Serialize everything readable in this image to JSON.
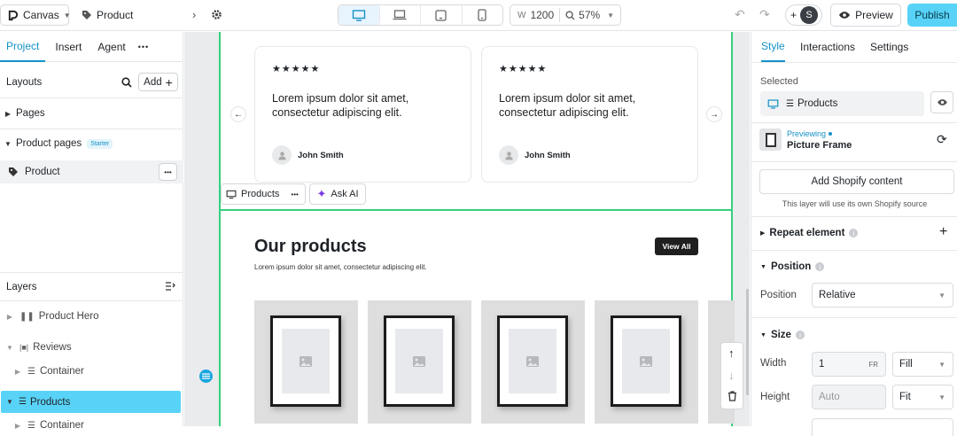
{
  "topbar": {
    "app_label": "Canvas",
    "page_label": "Product",
    "width_prefix": "W",
    "width_value": "1200",
    "zoom": "57%",
    "preview_label": "Preview",
    "publish_label": "Publish",
    "user_initial": "S",
    "plus": "+"
  },
  "left": {
    "tabs": [
      "Project",
      "Insert",
      "Agent"
    ],
    "more": "•••",
    "layouts_title": "Layouts",
    "add_label": "Add",
    "pages_label": "Pages",
    "product_pages_label": "Product pages",
    "starter_badge": "Starter",
    "product_item": "Product",
    "layers_title": "Layers",
    "layers": [
      "Product Hero",
      "Reviews",
      "Container",
      "Products",
      "Container"
    ]
  },
  "canvas": {
    "reviews": [
      {
        "stars": "★★★★★",
        "quote": "Lorem ipsum dolor sit amet, consectetur adipiscing elit.",
        "author": "John Smith"
      },
      {
        "stars": "★★★★★",
        "quote": "Lorem ipsum dolor sit amet, consectetur adipiscing elit.",
        "author": "John Smith"
      }
    ],
    "products_chip": "Products",
    "ask_ai": "Ask AI",
    "section_title": "Our products",
    "section_subtitle": "Lorem ipsum dolor sit amet, consectetur adipiscing elit.",
    "view_all": "View All"
  },
  "right": {
    "tabs": [
      "Style",
      "Interactions",
      "Settings"
    ],
    "selected_label": "Selected",
    "selected_value": "Products",
    "previewing_label": "Previewing",
    "previewing_value": "Picture Frame",
    "add_shopify": "Add Shopify content",
    "shopify_note": "This layer will use its own Shopify source",
    "repeat_element": "Repeat element",
    "position_title": "Position",
    "position_label": "Position",
    "position_value": "Relative",
    "size_title": "Size",
    "width_label": "Width",
    "width_value": "1",
    "width_unit": "FR",
    "width_mode": "Fill",
    "height_label": "Height",
    "height_placeholder": "Auto",
    "height_mode": "Fit"
  },
  "colors": {
    "accent": "#1592c8",
    "publish_bg": "#58d3f7",
    "selection": "#35d07f",
    "selected_layer": "#58d3f7"
  }
}
